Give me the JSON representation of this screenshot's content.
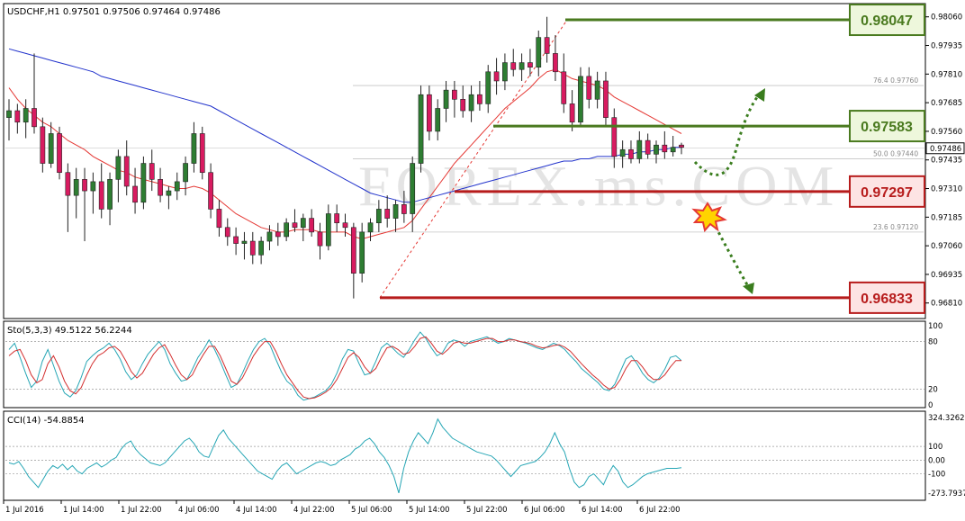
{
  "window": {
    "symbol_title": "USDCHF,H1  0.97501 0.97506 0.97464 0.97486"
  },
  "watermark": "FOREX.ms.COM",
  "colors": {
    "bull": "#2e7d32",
    "bear": "#d81b60",
    "ma_fast": "#e53935",
    "ma_slow": "#2233cc",
    "sto_main": "#26a6b5",
    "sto_signal": "#d32f2f",
    "cci": "#26a6b5",
    "resistance": "#4a7a1f",
    "support": "#b71c1c",
    "arrow": "#3a7d1e",
    "badge_green_bg": "#eef7dc",
    "badge_red_bg": "#fde4e4"
  },
  "chart_data": [
    {
      "type": "candlestick",
      "title": "USDCHF,H1  0.97501 0.97506 0.97464 0.97486",
      "ylim": [
        0.9675,
        0.9811
      ],
      "y_ticks": [
        "0.98060",
        "0.97935",
        "0.97810",
        "0.97685",
        "0.97560",
        "0.97435",
        "0.97310",
        "0.97185",
        "0.97060",
        "0.96935",
        "0.96810"
      ],
      "current_price_label": "0.97486",
      "x_ticks": [
        "1 Jul 2016",
        "1 Jul 14:00",
        "1 Jul 22:00",
        "4 Jul 06:00",
        "4 Jul 14:00",
        "4 Jul 22:00",
        "5 Jul 06:00",
        "5 Jul 14:00",
        "5 Jul 22:00",
        "6 Jul 06:00",
        "6 Jul 14:00",
        "6 Jul 22:00"
      ],
      "ohlc": [
        [
          0.9762,
          0.977,
          0.9752,
          0.9765
        ],
        [
          0.9765,
          0.9768,
          0.9755,
          0.976
        ],
        [
          0.976,
          0.977,
          0.9753,
          0.9766
        ],
        [
          0.9766,
          0.979,
          0.9755,
          0.9758
        ],
        [
          0.9758,
          0.9762,
          0.9738,
          0.9742
        ],
        [
          0.9742,
          0.976,
          0.974,
          0.9755
        ],
        [
          0.9755,
          0.9758,
          0.9735,
          0.9738
        ],
        [
          0.9738,
          0.9742,
          0.9712,
          0.9728
        ],
        [
          0.9728,
          0.974,
          0.9718,
          0.9735
        ],
        [
          0.9735,
          0.974,
          0.9708,
          0.973
        ],
        [
          0.973,
          0.9738,
          0.972,
          0.9734
        ],
        [
          0.9734,
          0.9742,
          0.9718,
          0.9722
        ],
        [
          0.9722,
          0.9738,
          0.9715,
          0.9735
        ],
        [
          0.9735,
          0.9748,
          0.9725,
          0.9745
        ],
        [
          0.9745,
          0.9752,
          0.9728,
          0.9732
        ],
        [
          0.9732,
          0.974,
          0.972,
          0.9725
        ],
        [
          0.9725,
          0.9745,
          0.9722,
          0.9742
        ],
        [
          0.9742,
          0.9748,
          0.973,
          0.9735
        ],
        [
          0.9735,
          0.974,
          0.9725,
          0.9728
        ],
        [
          0.9728,
          0.9732,
          0.9722,
          0.973
        ],
        [
          0.973,
          0.9738,
          0.9726,
          0.9734
        ],
        [
          0.9734,
          0.9745,
          0.9728,
          0.9742
        ],
        [
          0.9742,
          0.976,
          0.9738,
          0.9755
        ],
        [
          0.9755,
          0.9758,
          0.9735,
          0.9738
        ],
        [
          0.9738,
          0.9742,
          0.9718,
          0.9722
        ],
        [
          0.9722,
          0.9726,
          0.971,
          0.9714
        ],
        [
          0.9714,
          0.9718,
          0.9706,
          0.971
        ],
        [
          0.971,
          0.9714,
          0.9702,
          0.9707
        ],
        [
          0.9707,
          0.9712,
          0.97,
          0.9708
        ],
        [
          0.9708,
          0.9712,
          0.9698,
          0.9702
        ],
        [
          0.9702,
          0.971,
          0.9698,
          0.9708
        ],
        [
          0.9708,
          0.9715,
          0.9704,
          0.9712
        ],
        [
          0.9712,
          0.9716,
          0.9706,
          0.971
        ],
        [
          0.971,
          0.9718,
          0.9708,
          0.9716
        ],
        [
          0.9716,
          0.9722,
          0.9712,
          0.9714
        ],
        [
          0.9714,
          0.972,
          0.9708,
          0.9718
        ],
        [
          0.9718,
          0.9722,
          0.971,
          0.9712
        ],
        [
          0.9712,
          0.9716,
          0.97,
          0.9706
        ],
        [
          0.9706,
          0.9724,
          0.9704,
          0.972
        ],
        [
          0.972,
          0.9724,
          0.9712,
          0.9716
        ],
        [
          0.9716,
          0.972,
          0.971,
          0.9714
        ],
        [
          0.9714,
          0.9716,
          0.9683,
          0.9694
        ],
        [
          0.9694,
          0.9716,
          0.969,
          0.9712
        ],
        [
          0.9712,
          0.9718,
          0.9708,
          0.9716
        ],
        [
          0.9716,
          0.9726,
          0.9712,
          0.9722
        ],
        [
          0.9722,
          0.9728,
          0.9714,
          0.9718
        ],
        [
          0.9718,
          0.9726,
          0.9712,
          0.9724
        ],
        [
          0.9724,
          0.973,
          0.9716,
          0.972
        ],
        [
          0.972,
          0.9745,
          0.9712,
          0.9742
        ],
        [
          0.9742,
          0.9776,
          0.9738,
          0.9772
        ],
        [
          0.9772,
          0.9776,
          0.9752,
          0.9756
        ],
        [
          0.9756,
          0.977,
          0.9752,
          0.9766
        ],
        [
          0.9766,
          0.9778,
          0.976,
          0.9774
        ],
        [
          0.9774,
          0.9778,
          0.9762,
          0.977
        ],
        [
          0.977,
          0.9776,
          0.9762,
          0.9765
        ],
        [
          0.9765,
          0.9776,
          0.976,
          0.9772
        ],
        [
          0.9772,
          0.9778,
          0.9765,
          0.9768
        ],
        [
          0.9768,
          0.9785,
          0.9764,
          0.9782
        ],
        [
          0.9782,
          0.9788,
          0.9772,
          0.9778
        ],
        [
          0.9778,
          0.979,
          0.9774,
          0.9786
        ],
        [
          0.9786,
          0.9792,
          0.978,
          0.9783
        ],
        [
          0.9783,
          0.979,
          0.9778,
          0.9786
        ],
        [
          0.9786,
          0.9792,
          0.978,
          0.9784
        ],
        [
          0.9784,
          0.98,
          0.978,
          0.9797
        ],
        [
          0.9797,
          0.9806,
          0.9786,
          0.979
        ],
        [
          0.979,
          0.9798,
          0.9778,
          0.9782
        ],
        [
          0.9782,
          0.979,
          0.9764,
          0.9768
        ],
        [
          0.9768,
          0.9774,
          0.9756,
          0.976
        ],
        [
          0.976,
          0.9784,
          0.9758,
          0.978
        ],
        [
          0.978,
          0.9784,
          0.9766,
          0.977
        ],
        [
          0.977,
          0.9782,
          0.9766,
          0.9778
        ],
        [
          0.9778,
          0.9782,
          0.9758,
          0.9762
        ],
        [
          0.9762,
          0.9766,
          0.974,
          0.9745
        ],
        [
          0.9745,
          0.9752,
          0.974,
          0.9748
        ],
        [
          0.9748,
          0.9752,
          0.9742,
          0.9744
        ],
        [
          0.9744,
          0.9756,
          0.9742,
          0.9752
        ],
        [
          0.9752,
          0.9755,
          0.9744,
          0.9746
        ],
        [
          0.9746,
          0.9752,
          0.9742,
          0.975
        ],
        [
          0.975,
          0.9756,
          0.9744,
          0.9747
        ],
        [
          0.9747,
          0.9754,
          0.9745,
          0.9749
        ],
        [
          0.975,
          0.9751,
          0.9746,
          0.9749
        ]
      ],
      "series": [
        {
          "values": [
            0.9775,
            0.977,
            0.9766,
            0.9763,
            0.976,
            0.9758,
            0.9755,
            0.9752,
            0.975,
            0.9748,
            0.9745,
            0.9743,
            0.9741,
            0.9739,
            0.9738,
            0.9736,
            0.9735,
            0.9734,
            0.9733,
            0.9732,
            0.9731,
            0.9731,
            0.9732,
            0.9731,
            0.9729,
            0.9726,
            0.9723,
            0.972,
            0.9718,
            0.9716,
            0.9714,
            0.9713,
            0.9712,
            0.9712,
            0.9713,
            0.9713,
            0.9713,
            0.9712,
            0.9712,
            0.9712,
            0.9712,
            0.971,
            0.9709,
            0.971,
            0.9711,
            0.9712,
            0.9713,
            0.9714,
            0.9717,
            0.9722,
            0.9727,
            0.9732,
            0.9737,
            0.9742,
            0.9746,
            0.975,
            0.9754,
            0.9758,
            0.9762,
            0.9766,
            0.9769,
            0.9772,
            0.9775,
            0.9779,
            0.9782,
            0.9783,
            0.9781,
            0.9779,
            0.9778,
            0.9777,
            0.9776,
            0.9774,
            0.9771,
            0.9769,
            0.9767,
            0.9765,
            0.9763,
            0.9761,
            0.9759,
            0.9757,
            0.9755
          ]
        },
        {
          "values": [
            0.9792,
            0.9791,
            0.979,
            0.9789,
            0.9788,
            0.9787,
            0.9786,
            0.9785,
            0.9784,
            0.9783,
            0.9782,
            0.978,
            0.9779,
            0.9778,
            0.9777,
            0.9776,
            0.9775,
            0.9774,
            0.9773,
            0.9772,
            0.9771,
            0.977,
            0.9769,
            0.9768,
            0.9767,
            0.9765,
            0.9763,
            0.9761,
            0.9759,
            0.9757,
            0.9755,
            0.9753,
            0.9751,
            0.9749,
            0.9747,
            0.9745,
            0.9743,
            0.9741,
            0.9739,
            0.9737,
            0.9735,
            0.9733,
            0.9731,
            0.9729,
            0.9728,
            0.9727,
            0.9726,
            0.9725,
            0.9725,
            0.9726,
            0.9727,
            0.9728,
            0.9729,
            0.973,
            0.9731,
            0.9732,
            0.9733,
            0.9734,
            0.9735,
            0.9736,
            0.9737,
            0.9738,
            0.9739,
            0.974,
            0.9741,
            0.9742,
            0.9743,
            0.9743,
            0.9744,
            0.9744,
            0.9745,
            0.9745,
            0.9745,
            0.9746,
            0.9746,
            0.9747,
            0.9747,
            0.9748,
            0.9748,
            0.9749,
            0.9749
          ]
        }
      ],
      "levels": [
        {
          "label": "0.98047",
          "value": 0.98047,
          "kind": "resistance"
        },
        {
          "label": "0.97583",
          "value": 0.97583,
          "kind": "resistance"
        },
        {
          "label": "0.97297",
          "value": 0.97297,
          "kind": "support"
        },
        {
          "label": "0.96833",
          "value": 0.96833,
          "kind": "support"
        }
      ],
      "fibonacci": [
        {
          "label": "76.4  0.97760",
          "value": 0.9776
        },
        {
          "label": "50.0  0.97440",
          "value": 0.9744
        },
        {
          "label": "23.6  0.97120",
          "value": 0.9712
        }
      ]
    },
    {
      "type": "line",
      "title": "Sto(5,3,3) 49.5122 56.2244",
      "ylim": [
        0,
        100
      ],
      "y_ticks": [
        "100",
        "80",
        "20",
        "0"
      ],
      "series": [
        {
          "values": [
            70,
            78,
            60,
            40,
            22,
            30,
            55,
            70,
            50,
            30,
            15,
            10,
            18,
            35,
            55,
            62,
            68,
            72,
            78,
            70,
            58,
            42,
            32,
            38,
            52,
            64,
            72,
            80,
            70,
            52,
            40,
            30,
            32,
            45,
            60,
            70,
            82,
            70,
            55,
            38,
            22,
            26,
            40,
            56,
            70,
            80,
            84,
            75,
            58,
            42,
            30,
            24,
            12,
            6,
            8,
            10,
            14,
            18,
            26,
            40,
            58,
            70,
            68,
            52,
            38,
            40,
            55,
            72,
            78,
            72,
            65,
            60,
            70,
            82,
            92,
            84,
            72,
            62,
            66,
            78,
            82,
            80,
            74,
            80,
            82,
            84,
            86,
            82,
            78,
            80,
            84,
            82,
            80,
            78,
            75,
            72,
            70,
            74,
            78,
            75,
            70,
            62,
            55,
            46,
            40,
            34,
            28,
            20,
            18,
            26,
            42,
            58,
            62,
            52,
            40,
            32,
            28,
            34,
            45,
            60,
            62,
            56
          ]
        },
        {
          "values": [
            62,
            68,
            70,
            56,
            38,
            28,
            32,
            52,
            62,
            48,
            30,
            18,
            14,
            22,
            38,
            52,
            62,
            66,
            72,
            74,
            68,
            56,
            42,
            34,
            40,
            52,
            64,
            72,
            76,
            64,
            50,
            38,
            32,
            38,
            52,
            64,
            74,
            74,
            62,
            46,
            30,
            26,
            34,
            48,
            62,
            72,
            80,
            80,
            68,
            52,
            38,
            28,
            18,
            10,
            8,
            9,
            12,
            16,
            22,
            32,
            46,
            60,
            66,
            60,
            48,
            40,
            46,
            60,
            72,
            74,
            70,
            64,
            66,
            74,
            84,
            86,
            78,
            68,
            64,
            70,
            78,
            80,
            78,
            78,
            80,
            82,
            84,
            84,
            80,
            80,
            82,
            82,
            80,
            79,
            77,
            74,
            72,
            73,
            75,
            76,
            73,
            68,
            60,
            52,
            45,
            38,
            32,
            25,
            20,
            22,
            32,
            46,
            56,
            56,
            48,
            38,
            32,
            32,
            38,
            48,
            56,
            56
          ]
        }
      ]
    },
    {
      "type": "line",
      "title": "CCI(14) -54.8854",
      "ylim": [
        -273.7937,
        324.3262
      ],
      "y_ticks": [
        "324.3262",
        "100",
        "0.00",
        "-100",
        "-273.7937"
      ],
      "series": [
        {
          "values": [
            -20,
            -30,
            -10,
            -60,
            -120,
            -160,
            -200,
            -140,
            -80,
            -40,
            -60,
            -30,
            -70,
            -40,
            -80,
            -100,
            -60,
            -40,
            -20,
            -50,
            -30,
            0,
            20,
            80,
            120,
            140,
            80,
            40,
            10,
            -20,
            -30,
            -40,
            -20,
            20,
            60,
            100,
            140,
            160,
            120,
            60,
            30,
            20,
            100,
            180,
            220,
            160,
            120,
            80,
            40,
            0,
            -40,
            -80,
            -100,
            -120,
            -140,
            -80,
            -40,
            -20,
            -60,
            -100,
            -80,
            -60,
            -40,
            -20,
            -10,
            -20,
            -40,
            -30,
            0,
            20,
            40,
            80,
            100,
            140,
            160,
            120,
            60,
            20,
            -40,
            -120,
            -240,
            -60,
            60,
            140,
            200,
            160,
            120,
            200,
            300,
            240,
            200,
            160,
            140,
            120,
            100,
            80,
            60,
            50,
            40,
            30,
            0,
            -40,
            -80,
            -120,
            -80,
            -40,
            -30,
            -20,
            -10,
            20,
            60,
            120,
            200,
            120,
            60,
            -60,
            -160,
            -200,
            -180,
            -120,
            -100,
            -140,
            -180,
            -100,
            -40,
            -80,
            -160,
            -200,
            -180,
            -150,
            -120,
            -100,
            -90,
            -80,
            -70,
            -60,
            -60,
            -60,
            -55
          ]
        }
      ]
    }
  ]
}
